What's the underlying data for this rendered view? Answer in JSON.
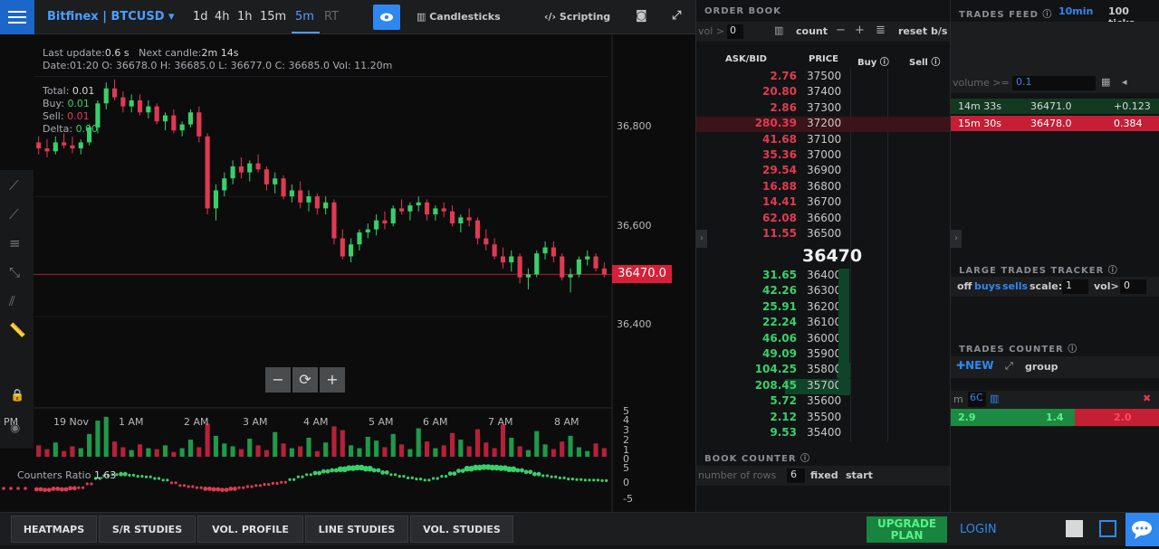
{
  "header": {
    "ticker": "Bitfinex | BTCUSD",
    "timeframes": [
      "1d",
      "4h",
      "1h",
      "15m",
      "5m",
      "RT"
    ],
    "active_timeframe": "5m",
    "candlesticks_label": "Candlesticks",
    "scripting_label": "Scripting"
  },
  "chart_info": {
    "last_update_label": "Last update:",
    "last_update": "0.6 s",
    "next_candle_label": "Next candle:",
    "next_candle": "2m 14s",
    "ohlc_line": "Date:01:20 O: 36678.0 H: 36685.0 L: 36677.0 C: 36685.0 Vol: 11.20m",
    "total_label": "Total:",
    "total": "0.01",
    "buy_label": "Buy:",
    "buy": "0.01",
    "sell_label": "Sell:",
    "sell": "0.01",
    "delta_label": "Delta:",
    "delta": "0.00"
  },
  "price_axis": [
    "36,800",
    "36,600",
    "36,400"
  ],
  "last_price_tag": "36470.0",
  "time_axis": [
    "PM",
    "19 Nov",
    "1 AM",
    "2 AM",
    "3 AM",
    "4 AM",
    "5 AM",
    "6 AM",
    "7 AM",
    "8 AM"
  ],
  "volume_axis": [
    "5",
    "4",
    "3",
    "2",
    "1",
    "0",
    "5",
    "0",
    "-5"
  ],
  "counters_ratio_label": "Counters Ratio",
  "counters_ratio": "1.63",
  "zoom": {
    "minus": "−",
    "reset": "⟳",
    "plus": "+"
  },
  "orderbook": {
    "title": "ORDER BOOK",
    "vol_label": "vol >",
    "vol_value": "0",
    "count_label": "count",
    "reset_label": "reset b/s",
    "col_askbid": "ASK/BID",
    "col_price": "PRICE",
    "col_buy": "Buy",
    "col_sell": "Sell",
    "asks": [
      {
        "amt": "2.76",
        "price": "37500"
      },
      {
        "amt": "20.80",
        "price": "37400"
      },
      {
        "amt": "2.86",
        "price": "37300"
      },
      {
        "amt": "280.39",
        "price": "37200"
      },
      {
        "amt": "41.68",
        "price": "37100"
      },
      {
        "amt": "35.36",
        "price": "37000"
      },
      {
        "amt": "29.54",
        "price": "36900"
      },
      {
        "amt": "16.88",
        "price": "36800"
      },
      {
        "amt": "14.41",
        "price": "36700"
      },
      {
        "amt": "62.08",
        "price": "36600"
      },
      {
        "amt": "11.55",
        "price": "36500"
      }
    ],
    "mid_price": "36470",
    "bids": [
      {
        "amt": "31.65",
        "price": "36400"
      },
      {
        "amt": "42.26",
        "price": "36300"
      },
      {
        "amt": "25.91",
        "price": "36200"
      },
      {
        "amt": "22.24",
        "price": "36100"
      },
      {
        "amt": "46.06",
        "price": "36000"
      },
      {
        "amt": "49.09",
        "price": "35900"
      },
      {
        "amt": "104.25",
        "price": "35800"
      },
      {
        "amt": "208.45",
        "price": "35700"
      },
      {
        "amt": "5.72",
        "price": "35600"
      },
      {
        "amt": "2.12",
        "price": "35500"
      },
      {
        "amt": "9.53",
        "price": "35400"
      }
    ],
    "book_counter_title": "BOOK COUNTER",
    "rows_label": "number of rows",
    "rows_value": "6",
    "fixed_label": "fixed",
    "start_label": "start"
  },
  "trades_feed": {
    "title": "TRADES FEED",
    "range_10min": "10min",
    "range_100ticks": "100 ticks",
    "volume_label": "volume >=",
    "volume_value": "0.1",
    "rows": [
      {
        "time": "14m 33s",
        "price": "36471.0",
        "size": "+0.123",
        "side": "buy"
      },
      {
        "time": "15m 30s",
        "price": "36478.0",
        "size": "0.384",
        "side": "sell"
      }
    ],
    "large_trades_title": "LARGE TRADES TRACKER",
    "off_label": "off",
    "buys_label": "buys",
    "sells_label": "sells",
    "scale_label": "scale:",
    "scale_value": "1",
    "vol_label": "vol>",
    "vol_value": "0",
    "trades_counter_title": "TRADES COUNTER",
    "new_label": "NEW",
    "group_label": "group",
    "counter_m": "m",
    "counter_tag": "6C",
    "counter_values": [
      "2.9",
      "1.4",
      "2.0"
    ]
  },
  "bottom": {
    "buttons": [
      "HEATMAPS",
      "S/R STUDIES",
      "VOL. PROFILE",
      "LINE STUDIES",
      "VOL. STUDIES"
    ],
    "upgrade": "UPGRADE PLAN",
    "login": "LOGIN"
  },
  "chart_data": {
    "type": "candlestick",
    "y_range": [
      36350,
      36870
    ],
    "last_price": 36470,
    "candles": [
      [
        36690,
        36700,
        36670,
        36680
      ],
      [
        36680,
        36695,
        36665,
        36675
      ],
      [
        36675,
        36700,
        36670,
        36690
      ],
      [
        36690,
        36705,
        36680,
        36685
      ],
      [
        36685,
        36700,
        36672,
        36680
      ],
      [
        36680,
        36695,
        36670,
        36690
      ],
      [
        36690,
        36720,
        36685,
        36715
      ],
      [
        36715,
        36760,
        36705,
        36755
      ],
      [
        36755,
        36790,
        36745,
        36780
      ],
      [
        36780,
        36795,
        36760,
        36765
      ],
      [
        36765,
        36775,
        36740,
        36750
      ],
      [
        36750,
        36770,
        36740,
        36760
      ],
      [
        36760,
        36770,
        36735,
        36740
      ],
      [
        36740,
        36760,
        36730,
        36750
      ],
      [
        36750,
        36755,
        36720,
        36725
      ],
      [
        36725,
        36740,
        36710,
        36735
      ],
      [
        36735,
        36745,
        36705,
        36710
      ],
      [
        36710,
        36725,
        36700,
        36720
      ],
      [
        36720,
        36745,
        36715,
        36740
      ],
      [
        36740,
        36750,
        36690,
        36700
      ],
      [
        36700,
        36705,
        36570,
        36580
      ],
      [
        36580,
        36620,
        36560,
        36610
      ],
      [
        36610,
        36640,
        36600,
        36630
      ],
      [
        36630,
        36660,
        36620,
        36650
      ],
      [
        36650,
        36665,
        36630,
        36640
      ],
      [
        36640,
        36660,
        36625,
        36655
      ],
      [
        36655,
        36670,
        36640,
        36645
      ],
      [
        36645,
        36650,
        36610,
        36620
      ],
      [
        36620,
        36640,
        36605,
        36630
      ],
      [
        36630,
        36635,
        36595,
        36600
      ],
      [
        36600,
        36620,
        36590,
        36610
      ],
      [
        36610,
        36625,
        36580,
        36590
      ],
      [
        36590,
        36610,
        36575,
        36600
      ],
      [
        36600,
        36605,
        36570,
        36580
      ],
      [
        36580,
        36600,
        36570,
        36590
      ],
      [
        36590,
        36595,
        36520,
        36530
      ],
      [
        36530,
        36545,
        36495,
        36500
      ],
      [
        36500,
        36530,
        36490,
        36520
      ],
      [
        36520,
        36545,
        36510,
        36540
      ],
      [
        36540,
        36555,
        36530,
        36545
      ],
      [
        36545,
        36570,
        36535,
        36560
      ],
      [
        36560,
        36575,
        36545,
        36555
      ],
      [
        36555,
        36585,
        36550,
        36580
      ],
      [
        36580,
        36595,
        36570,
        36575
      ],
      [
        36575,
        36590,
        36560,
        36585
      ],
      [
        36585,
        36600,
        36575,
        36590
      ],
      [
        36590,
        36595,
        36560,
        36570
      ],
      [
        36570,
        36585,
        36560,
        36580
      ],
      [
        36580,
        36590,
        36565,
        36575
      ],
      [
        36575,
        36585,
        36550,
        36555
      ],
      [
        36555,
        36570,
        36540,
        36565
      ],
      [
        36565,
        36580,
        36550,
        36560
      ],
      [
        36560,
        36565,
        36520,
        36530
      ],
      [
        36530,
        36545,
        36510,
        36520
      ],
      [
        36520,
        36530,
        36495,
        36500
      ],
      [
        36500,
        36515,
        36480,
        36490
      ],
      [
        36490,
        36510,
        36475,
        36500
      ],
      [
        36500,
        36505,
        36455,
        36465
      ],
      [
        36465,
        36480,
        36445,
        36470
      ],
      [
        36470,
        36510,
        36465,
        36505
      ],
      [
        36505,
        36525,
        36495,
        36515
      ],
      [
        36515,
        36525,
        36490,
        36500
      ],
      [
        36500,
        36505,
        36460,
        36465
      ],
      [
        36465,
        36480,
        36440,
        36470
      ],
      [
        36470,
        36500,
        36465,
        36495
      ],
      [
        36495,
        36510,
        36485,
        36500
      ],
      [
        36500,
        36505,
        36475,
        36480
      ],
      [
        36480,
        36490,
        36465,
        36470
      ]
    ],
    "volumes": [
      1.2,
      0.8,
      1.5,
      0.6,
      1.1,
      0.9,
      2.4,
      3.8,
      4.2,
      1.6,
      1.0,
      0.7,
      1.3,
      0.9,
      0.8,
      1.2,
      0.5,
      0.9,
      1.8,
      1.0,
      3.5,
      2.2,
      1.4,
      1.1,
      0.8,
      1.9,
      1.2,
      0.7,
      2.6,
      1.4,
      0.9,
      1.1,
      2.0,
      0.6,
      1.5,
      3.2,
      2.8,
      1.2,
      0.9,
      2.1,
      1.7,
      1.0,
      2.4,
      1.3,
      0.8,
      3.0,
      1.6,
      0.9,
      1.2,
      2.5,
      1.8,
      1.1,
      2.9,
      1.5,
      0.9,
      3.4,
      2.0,
      1.1,
      0.7,
      2.7,
      1.3,
      0.8,
      1.6,
      2.2,
      1.0,
      0.6,
      1.4,
      0.9
    ],
    "counters_ratio": [
      -1.5,
      -1.6,
      -1.4,
      -1.5,
      -1.3,
      -1.2,
      -0.5,
      0.5,
      1.0,
      1.2,
      1.3,
      1.1,
      0.9,
      0.8,
      0.5,
      0.2,
      -0.3,
      -0.8,
      -1.0,
      -1.2,
      -1.4,
      -1.5,
      -1.6,
      -1.4,
      -1.2,
      -1.0,
      -0.8,
      -0.6,
      -0.4,
      -0.2,
      0.3,
      0.8,
      1.2,
      1.5,
      1.8,
      2.0,
      2.2,
      2.4,
      2.5,
      2.3,
      2.0,
      1.6,
      1.2,
      0.9,
      0.6,
      0.4,
      0.2,
      0.5,
      0.9,
      1.4,
      1.9,
      2.3,
      2.5,
      2.6,
      2.5,
      2.4,
      2.2,
      2.0,
      1.7,
      1.3,
      1.0,
      0.8,
      0.6,
      0.4,
      0.3,
      0.2,
      0.2,
      0.1
    ]
  }
}
